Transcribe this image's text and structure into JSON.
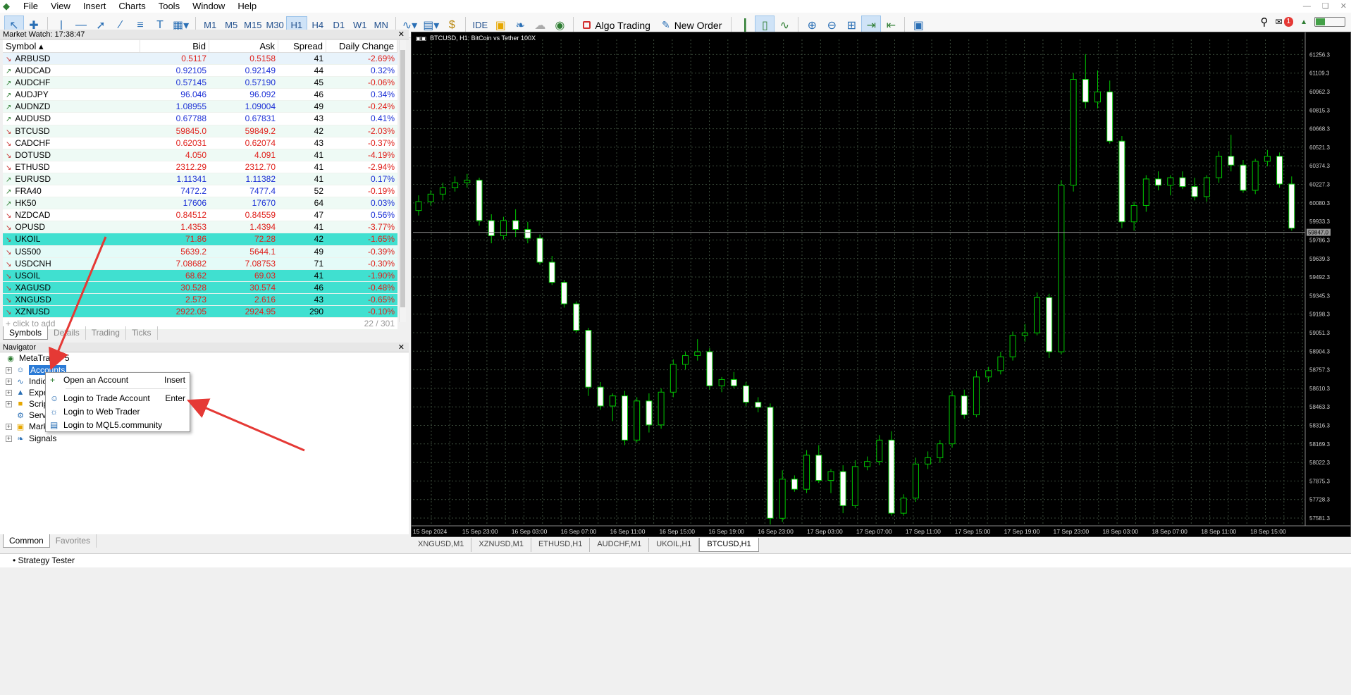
{
  "menu": [
    "File",
    "View",
    "Insert",
    "Charts",
    "Tools",
    "Window",
    "Help"
  ],
  "toolbar": {
    "timeframes": [
      "M1",
      "M5",
      "M15",
      "M30",
      "H1",
      "H4",
      "D1",
      "W1",
      "MN"
    ],
    "active_timeframe": "H1",
    "ide_label": "IDE",
    "algo_label": "Algo Trading",
    "new_order_label": "New Order",
    "notifications": "1"
  },
  "market_watch": {
    "title": "Market Watch: 17:38:47",
    "headers": {
      "symbol": "Symbol",
      "bid": "Bid",
      "ask": "Ask",
      "spread": "Spread",
      "change": "Daily Change"
    },
    "rows": [
      {
        "symbol": "ARBUSD",
        "dir": "down",
        "bid": "0.5117",
        "ask": "0.5158",
        "spread": "41",
        "change": "-2.69%",
        "bg": "#e8f3fb"
      },
      {
        "symbol": "AUDCAD",
        "dir": "up",
        "bid": "0.92105",
        "ask": "0.92149",
        "spread": "44",
        "change": "0.32%",
        "bg": "#ffffff"
      },
      {
        "symbol": "AUDCHF",
        "dir": "up",
        "bid": "0.57145",
        "ask": "0.57190",
        "spread": "45",
        "change": "-0.06%",
        "bg": "#eefaf5"
      },
      {
        "symbol": "AUDJPY",
        "dir": "up",
        "bid": "96.046",
        "ask": "96.092",
        "spread": "46",
        "change": "0.34%",
        "bg": "#ffffff"
      },
      {
        "symbol": "AUDNZD",
        "dir": "up",
        "bid": "1.08955",
        "ask": "1.09004",
        "spread": "49",
        "change": "-0.24%",
        "bg": "#eefaf5"
      },
      {
        "symbol": "AUDUSD",
        "dir": "up",
        "bid": "0.67788",
        "ask": "0.67831",
        "spread": "43",
        "change": "0.41%",
        "bg": "#ffffff"
      },
      {
        "symbol": "BTCUSD",
        "dir": "down",
        "bid": "59845.0",
        "ask": "59849.2",
        "spread": "42",
        "change": "-2.03%",
        "bg": "#eefaf5"
      },
      {
        "symbol": "CADCHF",
        "dir": "down",
        "bid": "0.62031",
        "ask": "0.62074",
        "spread": "43",
        "change": "-0.37%",
        "bg": "#ffffff"
      },
      {
        "symbol": "DOTUSD",
        "dir": "down",
        "bid": "4.050",
        "ask": "4.091",
        "spread": "41",
        "change": "-4.19%",
        "bg": "#eefaf5"
      },
      {
        "symbol": "ETHUSD",
        "dir": "down",
        "bid": "2312.29",
        "ask": "2312.70",
        "spread": "41",
        "change": "-2.94%",
        "bg": "#ffffff"
      },
      {
        "symbol": "EURUSD",
        "dir": "up",
        "bid": "1.11341",
        "ask": "1.11382",
        "spread": "41",
        "change": "0.17%",
        "bg": "#eefaf5"
      },
      {
        "symbol": "FRA40",
        "dir": "up",
        "bid": "7472.2",
        "ask": "7477.4",
        "spread": "52",
        "change": "-0.19%",
        "bg": "#ffffff"
      },
      {
        "symbol": "HK50",
        "dir": "up",
        "bid": "17606",
        "ask": "17670",
        "spread": "64",
        "change": "0.03%",
        "bg": "#eefaf5"
      },
      {
        "symbol": "NZDCAD",
        "dir": "down",
        "bid": "0.84512",
        "ask": "0.84559",
        "spread": "47",
        "change": "0.56%",
        "bg": "#ffffff"
      },
      {
        "symbol": "OPUSD",
        "dir": "down",
        "bid": "1.4353",
        "ask": "1.4394",
        "spread": "41",
        "change": "-3.77%",
        "bg": "#eefaf5"
      },
      {
        "symbol": "UKOIL",
        "dir": "down",
        "bid": "71.86",
        "ask": "72.28",
        "spread": "42",
        "change": "-1.65%",
        "bg": "#40e0d0"
      },
      {
        "symbol": "US500",
        "dir": "down",
        "bid": "5639.2",
        "ask": "5644.1",
        "spread": "49",
        "change": "-0.39%",
        "bg": "#e4fbf8"
      },
      {
        "symbol": "USDCNH",
        "dir": "down",
        "bid": "7.08682",
        "ask": "7.08753",
        "spread": "71",
        "change": "-0.30%",
        "bg": "#e4fbf8"
      },
      {
        "symbol": "USOIL",
        "dir": "down",
        "bid": "68.62",
        "ask": "69.03",
        "spread": "41",
        "change": "-1.90%",
        "bg": "#40e0d0"
      },
      {
        "symbol": "XAGUSD",
        "dir": "down",
        "bid": "30.528",
        "ask": "30.574",
        "spread": "46",
        "change": "-0.48%",
        "bg": "#40e0d0"
      },
      {
        "symbol": "XNGUSD",
        "dir": "down",
        "bid": "2.573",
        "ask": "2.616",
        "spread": "43",
        "change": "-0.65%",
        "bg": "#40e0d0"
      },
      {
        "symbol": "XZNUSD",
        "dir": "down",
        "bid": "2922.05",
        "ask": "2924.95",
        "spread": "290",
        "change": "-0.10%",
        "bg": "#40e0d0"
      }
    ],
    "click_to_add": "click to add",
    "count": "22 / 301",
    "tabs": [
      "Symbols",
      "Details",
      "Trading",
      "Ticks"
    ]
  },
  "navigator": {
    "title": "Navigator",
    "root": "MetaTrader 5",
    "items": [
      "Accounts",
      "Indicators",
      "Expert Advisors",
      "Scripts",
      "Services",
      "Market",
      "Signals"
    ],
    "tabs": [
      "Common",
      "Favorites"
    ]
  },
  "context_menu": {
    "items": [
      {
        "label": "Open an Account",
        "shortcut": "Insert"
      },
      {
        "label": "Login to Trade Account",
        "shortcut": "Enter"
      },
      {
        "label": "Login to Web Trader",
        "shortcut": ""
      },
      {
        "label": "Login to MQL5.community",
        "shortcut": ""
      }
    ]
  },
  "chart": {
    "title": "BTCUSD, H1:  BitCoin vs Tether 100X",
    "current_price": "59847.0",
    "tabs": [
      "XNGUSD,M1",
      "XZNUSD,M1",
      "ETHUSD,H1",
      "AUDCHF,M1",
      "UKOIL,H1",
      "BTCUSD,H1"
    ],
    "active_tab": "BTCUSD,H1"
  },
  "chart_data": {
    "type": "candlestick",
    "y_ticks": [
      "61256.3",
      "61109.3",
      "60962.3",
      "60815.3",
      "60668.3",
      "60521.3",
      "60374.3",
      "60227.3",
      "60080.3",
      "59933.3",
      "59786.3",
      "59639.3",
      "59492.3",
      "59345.3",
      "59198.3",
      "59051.3",
      "58904.3",
      "58757.3",
      "58610.3",
      "58463.3",
      "58316.3",
      "58169.3",
      "58022.3",
      "57875.3",
      "57728.3",
      "57581.3"
    ],
    "x_ticks": [
      "15 Sep 2024",
      "15 Sep 23:00",
      "16 Sep 03:00",
      "16 Sep 07:00",
      "16 Sep 11:00",
      "16 Sep 15:00",
      "16 Sep 19:00",
      "16 Sep 23:00",
      "17 Sep 03:00",
      "17 Sep 07:00",
      "17 Sep 11:00",
      "17 Sep 15:00",
      "17 Sep 19:00",
      "17 Sep 23:00",
      "18 Sep 03:00",
      "18 Sep 07:00",
      "18 Sep 11:00",
      "18 Sep 15:00"
    ],
    "ylim": [
      57520,
      61320
    ],
    "candles": [
      [
        60020,
        60140,
        59980,
        60090
      ],
      [
        60090,
        60180,
        60060,
        60150
      ],
      [
        60150,
        60240,
        60100,
        60200
      ],
      [
        60200,
        60290,
        60170,
        60240
      ],
      [
        60240,
        60310,
        60200,
        60260
      ],
      [
        60260,
        60280,
        59900,
        59940
      ],
      [
        59940,
        59990,
        59760,
        59820
      ],
      [
        59820,
        59970,
        59790,
        59940
      ],
      [
        59940,
        60030,
        59810,
        59870
      ],
      [
        59870,
        59930,
        59760,
        59800
      ],
      [
        59800,
        59830,
        59590,
        59610
      ],
      [
        59610,
        59660,
        59430,
        59450
      ],
      [
        59450,
        59470,
        59250,
        59280
      ],
      [
        59280,
        59300,
        59050,
        59070
      ],
      [
        59070,
        59090,
        58550,
        58620
      ],
      [
        58620,
        58660,
        58440,
        58470
      ],
      [
        58470,
        58570,
        58350,
        58550
      ],
      [
        58550,
        58590,
        58160,
        58200
      ],
      [
        58200,
        58540,
        58180,
        58510
      ],
      [
        58510,
        58570,
        58260,
        58320
      ],
      [
        58320,
        58610,
        58290,
        58580
      ],
      [
        58580,
        58840,
        58540,
        58800
      ],
      [
        58800,
        58900,
        58760,
        58870
      ],
      [
        58870,
        59000,
        58830,
        58900
      ],
      [
        58900,
        58930,
        58600,
        58630
      ],
      [
        58630,
        58700,
        58580,
        58680
      ],
      [
        58680,
        58740,
        58610,
        58630
      ],
      [
        58630,
        58660,
        58470,
        58500
      ],
      [
        58500,
        58540,
        58420,
        58460
      ],
      [
        58460,
        58490,
        57530,
        57580
      ],
      [
        57580,
        57960,
        57550,
        57890
      ],
      [
        57890,
        57920,
        57790,
        57810
      ],
      [
        57810,
        58120,
        57780,
        58080
      ],
      [
        58080,
        58160,
        57860,
        57880
      ],
      [
        57880,
        57970,
        57780,
        57950
      ],
      [
        57950,
        58000,
        57620,
        57680
      ],
      [
        57680,
        58040,
        57660,
        57990
      ],
      [
        57990,
        58070,
        57960,
        58030
      ],
      [
        58030,
        58240,
        58000,
        58200
      ],
      [
        58200,
        58270,
        57600,
        57620
      ],
      [
        57620,
        57770,
        57600,
        57740
      ],
      [
        57740,
        58060,
        57710,
        58010
      ],
      [
        58010,
        58110,
        57970,
        58060
      ],
      [
        58060,
        58200,
        58020,
        58170
      ],
      [
        58170,
        58590,
        58140,
        58550
      ],
      [
        58550,
        58600,
        58370,
        58400
      ],
      [
        58400,
        58750,
        58380,
        58700
      ],
      [
        58700,
        58780,
        58660,
        58750
      ],
      [
        58750,
        58900,
        58720,
        58860
      ],
      [
        58860,
        59060,
        58830,
        59030
      ],
      [
        59030,
        59120,
        58980,
        59050
      ],
      [
        59050,
        59370,
        59030,
        59330
      ],
      [
        59330,
        59360,
        58850,
        58900
      ],
      [
        58900,
        60260,
        58880,
        60220
      ],
      [
        60220,
        61110,
        60170,
        61060
      ],
      [
        61060,
        61260,
        60830,
        60880
      ],
      [
        60880,
        61130,
        60830,
        60960
      ],
      [
        60960,
        61050,
        60550,
        60570
      ],
      [
        60570,
        60610,
        59880,
        59930
      ],
      [
        59930,
        60090,
        59860,
        60060
      ],
      [
        60060,
        60300,
        60010,
        60270
      ],
      [
        60270,
        60330,
        60180,
        60220
      ],
      [
        60220,
        60300,
        60140,
        60280
      ],
      [
        60280,
        60330,
        60190,
        60210
      ],
      [
        60210,
        60280,
        60100,
        60130
      ],
      [
        60130,
        60300,
        60090,
        60280
      ],
      [
        60280,
        60490,
        60240,
        60450
      ],
      [
        60450,
        60620,
        60330,
        60380
      ],
      [
        60380,
        60420,
        60160,
        60180
      ],
      [
        60180,
        60430,
        60150,
        60410
      ],
      [
        60410,
        60500,
        60370,
        60450
      ],
      [
        60450,
        60480,
        60200,
        60230
      ],
      [
        60230,
        60290,
        59860,
        59880
      ]
    ]
  }
}
